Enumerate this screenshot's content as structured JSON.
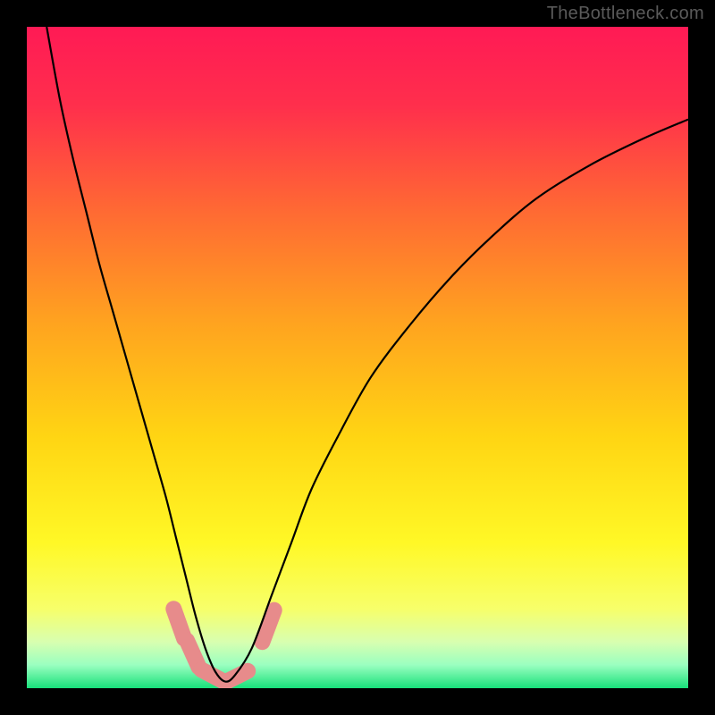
{
  "watermark": "TheBottleneck.com",
  "chart_data": {
    "type": "line",
    "title": "",
    "xlabel": "",
    "ylabel": "",
    "xlim": [
      0,
      100
    ],
    "ylim": [
      0,
      100
    ],
    "grid": false,
    "legend": false,
    "annotations": [],
    "background_gradient_stops": [
      {
        "pos": 0.0,
        "color": "#ff1a55"
      },
      {
        "pos": 0.12,
        "color": "#ff2f4c"
      },
      {
        "pos": 0.28,
        "color": "#ff6a33"
      },
      {
        "pos": 0.45,
        "color": "#ffa41f"
      },
      {
        "pos": 0.62,
        "color": "#ffd513"
      },
      {
        "pos": 0.78,
        "color": "#fff826"
      },
      {
        "pos": 0.88,
        "color": "#f7ff6a"
      },
      {
        "pos": 0.93,
        "color": "#d8ffb0"
      },
      {
        "pos": 0.965,
        "color": "#9affc0"
      },
      {
        "pos": 1.0,
        "color": "#18e07a"
      }
    ],
    "series": [
      {
        "name": "bottleneck-curve",
        "stroke": "#000000",
        "stroke_width": 2.2,
        "x": [
          3,
          5,
          7,
          9,
          11,
          13,
          15,
          17,
          19,
          21,
          22.5,
          24,
          25.5,
          27,
          28.5,
          30,
          31.5,
          34,
          37,
          40,
          43,
          47,
          52,
          58,
          64,
          70,
          77,
          85,
          93,
          100
        ],
        "y": [
          100,
          89,
          80,
          72,
          64,
          57,
          50,
          43,
          36,
          29,
          23,
          17,
          11,
          6,
          2.5,
          1.0,
          2.0,
          6,
          14,
          22,
          30,
          38,
          47,
          55,
          62,
          68,
          74,
          79,
          83,
          86
        ]
      }
    ],
    "markers": {
      "name": "highlight-blobs",
      "fill": "#e78b8b",
      "shape": "capsule",
      "points": [
        {
          "x0": 22.2,
          "y0": 12.0,
          "x1": 23.8,
          "y1": 7.5
        },
        {
          "x0": 24.2,
          "y0": 7.2,
          "x1": 26.0,
          "y1": 3.2
        },
        {
          "x0": 26.4,
          "y0": 2.8,
          "x1": 29.8,
          "y1": 1.0
        },
        {
          "x0": 30.2,
          "y0": 1.0,
          "x1": 33.4,
          "y1": 2.6
        },
        {
          "x0": 35.6,
          "y0": 7.0,
          "x1": 37.4,
          "y1": 11.8
        }
      ]
    }
  }
}
